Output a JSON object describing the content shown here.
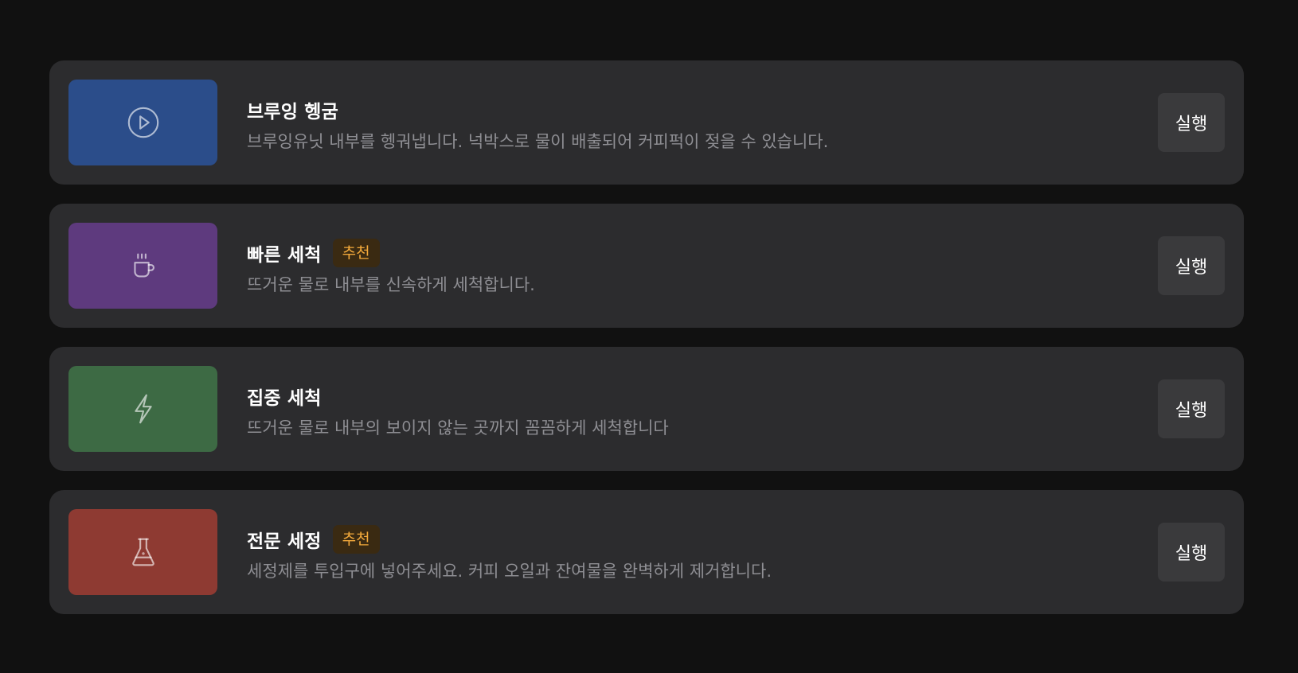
{
  "actions": [
    {
      "title": "브루잉 헹굼",
      "badge": "",
      "description": "브루잉유닛 내부를 헹궈냅니다. 넉박스로 물이 배출되어 커피퍽이 젖을 수 있습니다.",
      "button_label": "실행",
      "icon": "play-circle-icon",
      "color": "#2b4d8a"
    },
    {
      "title": "빠른 세척",
      "badge": "추천",
      "description": "뜨거운 물로 내부를 신속하게 세척합니다.",
      "button_label": "실행",
      "icon": "hot-cup-icon",
      "color": "#5e3a7e"
    },
    {
      "title": "집중 세척",
      "badge": "",
      "description": "뜨거운 물로 내부의 보이지 않는 곳까지 꼼꼼하게 세척합니다",
      "button_label": "실행",
      "icon": "lightning-icon",
      "color": "#3d6a44"
    },
    {
      "title": "전문 세정",
      "badge": "추천",
      "description": "세정제를 투입구에 넣어주세요. 커피 오일과 잔여물을 완벽하게 제거합니다.",
      "button_label": "실행",
      "icon": "flask-icon",
      "color": "#8e3a32"
    }
  ],
  "colors": {
    "background": "#111111",
    "card": "#2c2c2e",
    "button": "#3a3a3c",
    "badge_text": "#f2a93b",
    "badge_bg": "#3a2a12",
    "description": "#8e8e93"
  }
}
